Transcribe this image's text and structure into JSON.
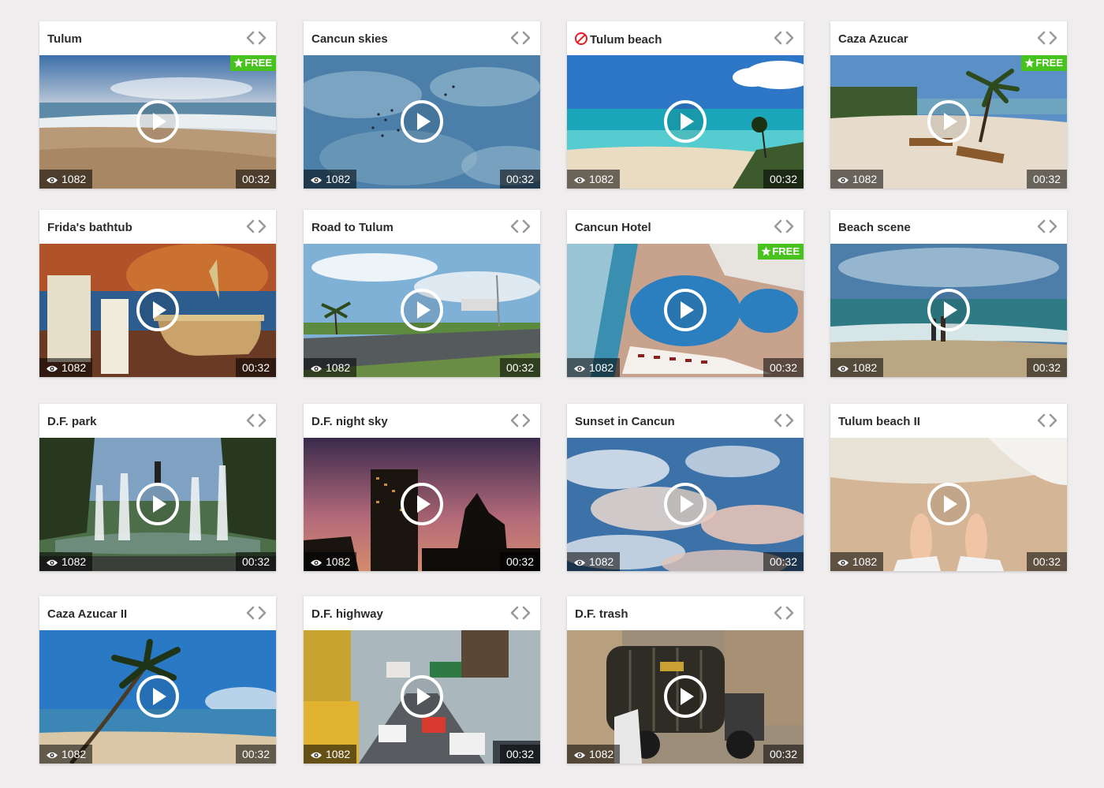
{
  "icons": {
    "embed": "code-icon",
    "play": "play-icon",
    "views": "eye-icon",
    "free": "star-icon",
    "blocked": "blocked-icon"
  },
  "colors": {
    "background": "#efedee",
    "free_badge": "#48c31d",
    "blocked": "#e31c23"
  },
  "videos": [
    {
      "title": "Tulum",
      "views": "1082",
      "duration": "00:32",
      "free": true,
      "free_label": "FREE",
      "blocked": false,
      "scene": "beach-sunrise"
    },
    {
      "title": "Cancun skies",
      "views": "1082",
      "duration": "00:32",
      "free": false,
      "blocked": false,
      "scene": "sky-birds"
    },
    {
      "title": "Tulum beach",
      "views": "1082",
      "duration": "00:32",
      "free": false,
      "blocked": true,
      "scene": "turquoise-beach"
    },
    {
      "title": "Caza Azucar",
      "views": "1082",
      "duration": "00:32",
      "free": true,
      "free_label": "FREE",
      "blocked": false,
      "scene": "palm-loungers"
    },
    {
      "title": "Frida's bathtub",
      "views": "1082",
      "duration": "00:32",
      "free": false,
      "blocked": false,
      "scene": "bathtub"
    },
    {
      "title": "Road to Tulum",
      "views": "1082",
      "duration": "00:32",
      "free": false,
      "blocked": false,
      "scene": "road"
    },
    {
      "title": "Cancun Hotel",
      "views": "1082",
      "duration": "00:32",
      "free": true,
      "free_label": "FREE",
      "blocked": false,
      "scene": "hotel-pool"
    },
    {
      "title": "Beach scene",
      "views": "1082",
      "duration": "00:32",
      "free": false,
      "blocked": false,
      "scene": "beach-people"
    },
    {
      "title": "D.F. park",
      "views": "1082",
      "duration": "00:32",
      "free": false,
      "blocked": false,
      "scene": "fountain"
    },
    {
      "title": "D.F. night sky",
      "views": "1082",
      "duration": "00:32",
      "free": false,
      "blocked": false,
      "scene": "night-city"
    },
    {
      "title": "Sunset in Cancun",
      "views": "1082",
      "duration": "00:32",
      "free": false,
      "blocked": false,
      "scene": "clouds"
    },
    {
      "title": "Tulum beach II",
      "views": "1082",
      "duration": "00:32",
      "free": false,
      "blocked": false,
      "scene": "feet-sand"
    },
    {
      "title": "Caza Azucar II",
      "views": "1082",
      "duration": "00:32",
      "free": false,
      "blocked": false,
      "scene": "palm-sea"
    },
    {
      "title": "D.F. highway",
      "views": "1082",
      "duration": "00:32",
      "free": false,
      "blocked": false,
      "scene": "traffic"
    },
    {
      "title": "D.F. trash",
      "views": "1082",
      "duration": "00:32",
      "free": false,
      "blocked": false,
      "scene": "truck"
    }
  ]
}
